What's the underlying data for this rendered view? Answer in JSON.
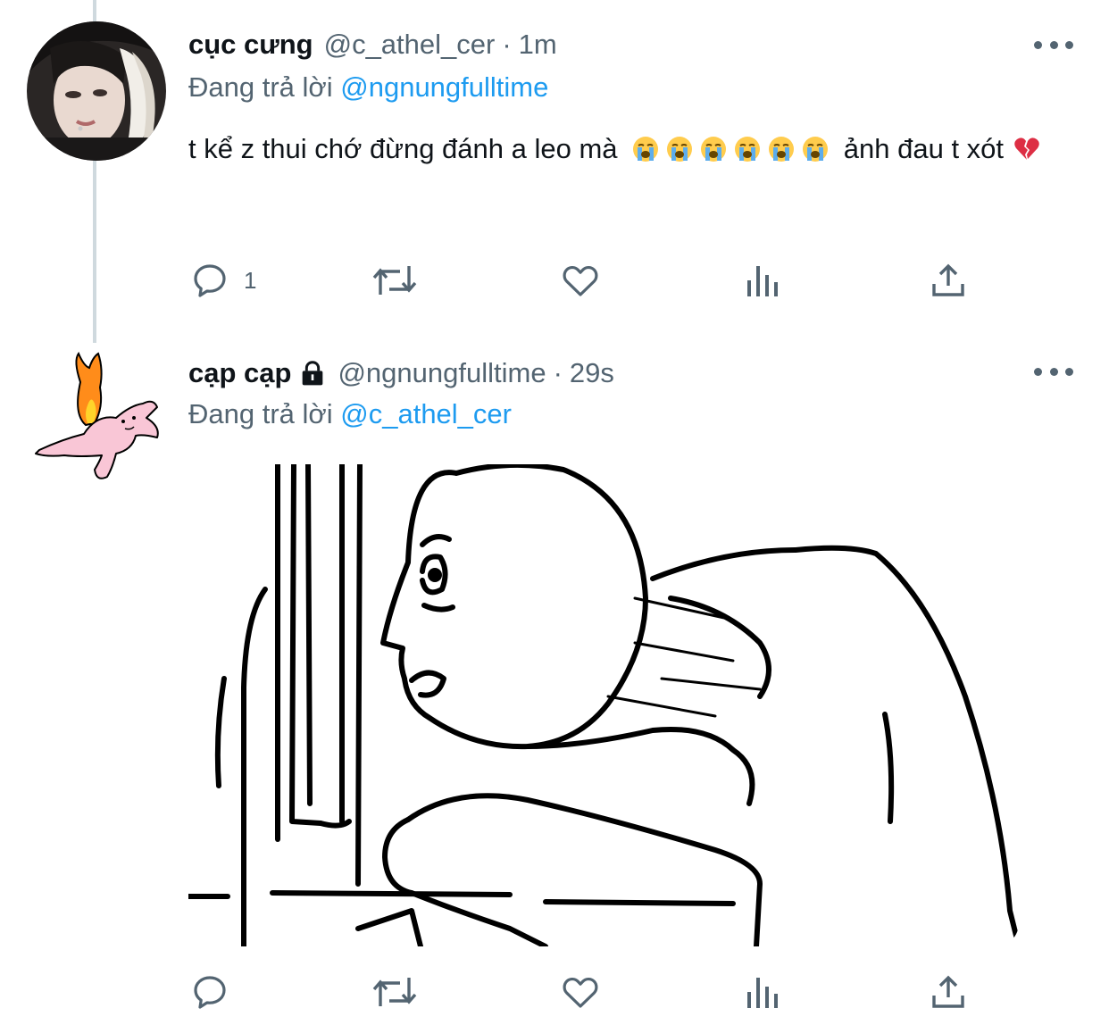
{
  "tweets": [
    {
      "display_name": "cục cưng",
      "handle": "@c_athel_cer",
      "separator": "·",
      "time": "1m",
      "reply_prefix": "Đang trả lời",
      "reply_to": "@ngnungfulltime",
      "text_part1": "t kể z thui chớ đừng đánh a leo mà",
      "text_part2": "ảnh đau t xót",
      "emojis": [
        "loudly-crying-face",
        "loudly-crying-face",
        "loudly-crying-face",
        "loudly-crying-face",
        "loudly-crying-face",
        "loudly-crying-face",
        "broken-heart"
      ],
      "reply_count": "1",
      "locked": false
    },
    {
      "display_name": "cạp cạp",
      "handle": "@ngnungfulltime",
      "separator": "·",
      "time": "29s",
      "reply_prefix": "Đang trả lời",
      "reply_to": "@c_athel_cer",
      "locked": true,
      "has_image": true
    }
  ],
  "icons": {
    "reply": "speech-bubble-icon",
    "retweet": "retweet-arrows-icon",
    "like": "heart-icon",
    "views": "bar-chart-icon",
    "share": "upload-share-icon",
    "more": "more-dots-icon",
    "lock": "lock-icon"
  },
  "colors": {
    "link": "#1d9bf0",
    "secondary_text": "#536471",
    "primary_text": "#0f1419",
    "thread_line": "#cfd9de"
  }
}
